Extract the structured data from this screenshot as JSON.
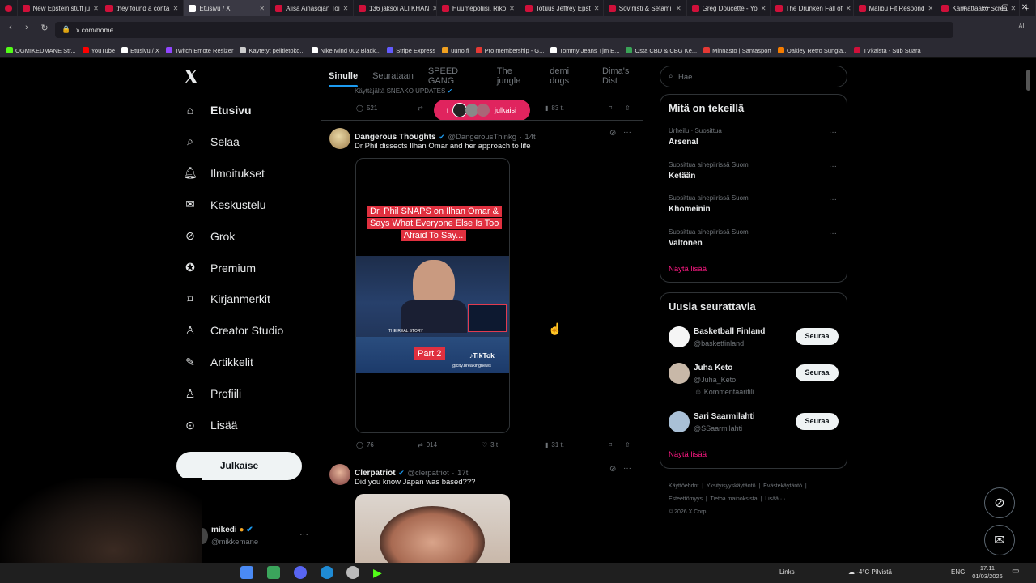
{
  "browser": {
    "tabs": [
      {
        "title": "New Epstein stuff ju",
        "color": "#d0103a"
      },
      {
        "title": "they found a conta",
        "color": "#d0103a"
      },
      {
        "title": "Etusivu / X",
        "color": "#ffffff"
      },
      {
        "title": "Alisa Ainasojan Toi",
        "color": "#d0103a"
      },
      {
        "title": "136 jaksoi ALI KHAN",
        "color": "#d0103a"
      },
      {
        "title": "Huumepoliisi, Riko",
        "color": "#d0103a"
      },
      {
        "title": "Totuus Jeffrey Epst",
        "color": "#d0103a"
      },
      {
        "title": "Sovinisti & Setämi",
        "color": "#d0103a"
      },
      {
        "title": "Greg Doucette - Yo",
        "color": "#d0103a"
      },
      {
        "title": "The Drunken Fall of",
        "color": "#d0103a"
      },
      {
        "title": "Malibu Fit Respond",
        "color": "#d0103a"
      },
      {
        "title": "Kannattaako Screa",
        "color": "#d0103a"
      }
    ],
    "url": "x.com/home",
    "bookmarks": [
      {
        "label": "OGMIKEDMANE Str...",
        "color": "#53fc18"
      },
      {
        "label": "YouTube",
        "color": "#ff0000"
      },
      {
        "label": "Etusivu / X",
        "color": "#ffffff"
      },
      {
        "label": "Twitch Emote Resizer",
        "color": "#9146ff"
      },
      {
        "label": "Käytetyt pelitietoko...",
        "color": "#cccccc"
      },
      {
        "label": "Nike Mind 002 Black...",
        "color": "#ffffff"
      },
      {
        "label": "Stripe Express",
        "color": "#635bff"
      },
      {
        "label": "uuno.fi",
        "color": "#f0a020"
      },
      {
        "label": "Pro membership - G...",
        "color": "#e53935"
      },
      {
        "label": "Tommy Jeans Tjm E...",
        "color": "#ffffff"
      },
      {
        "label": "Osta CBD & CBG Ke...",
        "color": "#3aa357"
      },
      {
        "label": "Minnasto | Santasport",
        "color": "#e53935"
      },
      {
        "label": "Oakley Retro Sungla...",
        "color": "#f57c00"
      },
      {
        "label": "TVkaista - Sub Suara",
        "color": "#d0103a"
      }
    ]
  },
  "nav": {
    "items": [
      {
        "label": "Etusivu",
        "icon": "home-icon"
      },
      {
        "label": "Selaa",
        "icon": "search-icon"
      },
      {
        "label": "Ilmoitukset",
        "icon": "bell-icon"
      },
      {
        "label": "Keskustelu",
        "icon": "mail-icon"
      },
      {
        "label": "Grok",
        "icon": "grok-icon"
      },
      {
        "label": "Premium",
        "icon": "premium-icon"
      },
      {
        "label": "Kirjanmerkit",
        "icon": "bookmark-icon"
      },
      {
        "label": "Creator Studio",
        "icon": "creator-icon"
      },
      {
        "label": "Artikkelit",
        "icon": "article-icon"
      },
      {
        "label": "Profiili",
        "icon": "profile-icon"
      },
      {
        "label": "Lisää",
        "icon": "more-icon"
      }
    ],
    "post_button": "Julkaise",
    "account": {
      "name": "mikedi",
      "handle": "@mikkemane"
    }
  },
  "feed": {
    "tabs": [
      "Sinulle",
      "Seurataan",
      "SPEED GANG",
      "The jungle",
      "demi dogs",
      "Dima's Dist"
    ],
    "top_fragment": {
      "text": "Käyttäjältä SNEAKO UPDATES",
      "replies": "521",
      "views": "83 t."
    },
    "new_posts_pill": "julkaisi",
    "tweets": [
      {
        "name": "Dangerous Thoughts",
        "handle": "@DangerousThinkg",
        "time": "14t",
        "text": "Dr Phil dissects Ilhan Omar and her approach to life",
        "video": {
          "caption": "Dr. Phil SNAPS on Ilhan Omar & Says What Everyone Else Is Too Afraid To Say...",
          "part_label": "Part 2",
          "tiktok_label": "TikTok",
          "tiktok_handle": "@city.breakingnews",
          "lower_third": "THE REAL STORY"
        },
        "replies": "76",
        "reposts": "914",
        "likes": "3 t",
        "views": "31 t."
      },
      {
        "name": "Clerpatriot",
        "handle": "@clerpatriot",
        "time": "17t",
        "text": "Did you know Japan was based???"
      }
    ]
  },
  "right": {
    "search_placeholder": "Hae",
    "trends_title": "Mitä on tekeillä",
    "trends": [
      {
        "context": "Urheilu · Suosittua",
        "name": "Arsenal"
      },
      {
        "context": "Suosittua aihepiirissä Suomi",
        "name": "Ketään"
      },
      {
        "context": "Suosittua aihepiirissä Suomi",
        "name": "Khomeinin"
      },
      {
        "context": "Suosittua aihepiirissä Suomi",
        "name": "Valtonen"
      }
    ],
    "show_more": "Näytä lisää",
    "who_title": "Uusia seurattavia",
    "who": [
      {
        "name": "Basketball Finland",
        "handle": "@basketfinland",
        "note": ""
      },
      {
        "name": "Juha Keto",
        "handle": "@Juha_Keto",
        "note": "Kommentaaritili"
      },
      {
        "name": "Sari Saarmilahti",
        "handle": "@SSaarmilahti",
        "note": ""
      }
    ],
    "follow_label": "Seuraa",
    "footer": [
      "Käyttöehdot",
      "Yksityisyyskäytäntö",
      "Evästekäytäntö",
      "Esteettömyys",
      "Tietoa mainoksista",
      "Lisää ···",
      "© 2026 X Corp."
    ]
  },
  "taskbar": {
    "links": "Links",
    "weather": "-4°C  Pilvistä",
    "lang": "ENG",
    "time": "17.11",
    "date": "01/03/2026"
  }
}
